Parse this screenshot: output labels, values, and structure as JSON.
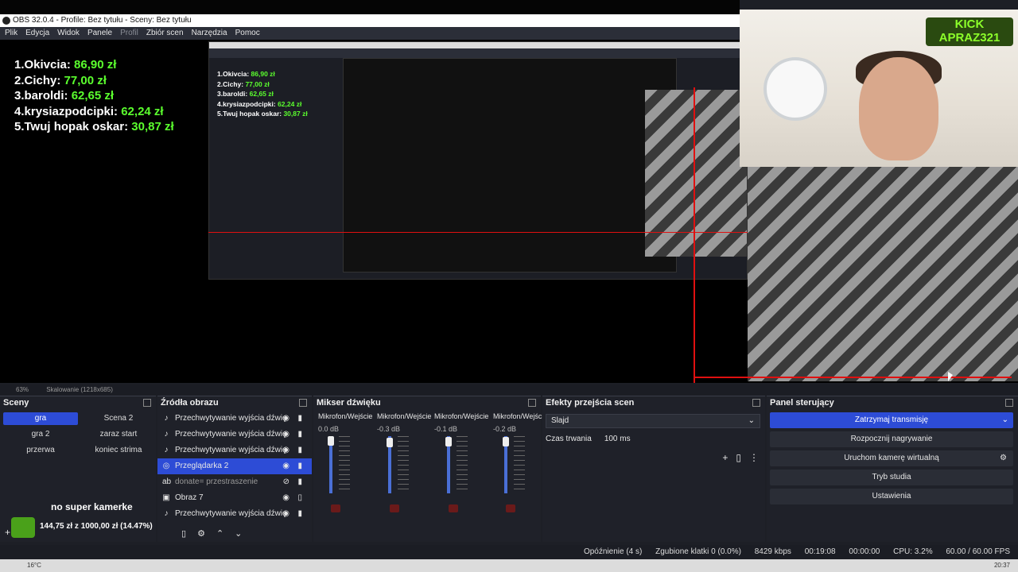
{
  "window": {
    "title": "OBS 32.0.4 - Profile: Bez tytułu - Sceny: Bez tytułu"
  },
  "menu": [
    "Plik",
    "Edycja",
    "Widok",
    "Panele",
    "Profil",
    "Zbiór scen",
    "Narzędzia",
    "Pomoc"
  ],
  "leaderboard": [
    {
      "label": "1.Okivcia: ",
      "value": "86,90 zł"
    },
    {
      "label": "2.Cichy: ",
      "value": "77,00 zł"
    },
    {
      "label": "3.baroldi: ",
      "value": "62,65 zł"
    },
    {
      "label": "4.krysiazpodcipki: ",
      "value": "62,24 zł"
    },
    {
      "label": "5.Twuj hopak oskar: ",
      "value": "30,87 zł"
    }
  ],
  "webcam": {
    "logo": "KICK APRAZ321"
  },
  "overlay": {
    "nsk": "no super kamerke",
    "progress": "144,75 zł z 1000,00 zł (14.47%)"
  },
  "zoom": {
    "level": "63%",
    "scale": "Skalowanie (1218x685)"
  },
  "scenes": {
    "title": "Sceny",
    "items": [
      "gra",
      "Scena 2",
      "gra 2",
      "zaraz start",
      "przerwa",
      "koniec strima"
    ]
  },
  "sources": {
    "title": "Źródła obrazu",
    "items": [
      {
        "label": "Przechwytywanie wyjścia dźwię",
        "icon": "speaker-icon"
      },
      {
        "label": "Przechwytywanie wyjścia dźwię",
        "icon": "speaker-icon"
      },
      {
        "label": "Przechwytywanie wyjścia dźwię",
        "icon": "speaker-icon"
      },
      {
        "label": "Przeglądarka 2",
        "icon": "globe-icon"
      },
      {
        "label": "donate= przestraszenie",
        "icon": "text-icon"
      },
      {
        "label": "Obraz 7",
        "icon": "image-icon"
      },
      {
        "label": "Przechwytywanie wyjścia dźwię",
        "icon": "speaker-icon"
      }
    ]
  },
  "mixer": {
    "title": "Mikser dźwięku",
    "channels": [
      {
        "name": "Mikrofon/Wejście li",
        "db": "0.0 dB"
      },
      {
        "name": "Mikrofon/Wejście li",
        "db": "-0.3 dB"
      },
      {
        "name": "Mikrofon/Wejście li",
        "db": "-0.1 dB"
      },
      {
        "name": "Mikrofon/Wejście",
        "db": "-0.2 dB"
      }
    ],
    "scale": [
      "0",
      "-5",
      "-10",
      "-15",
      "-20",
      "-25",
      "-30",
      "-35",
      "-40",
      "-45",
      "-50",
      "-55",
      "-60"
    ]
  },
  "effects": {
    "title": "Efekty przejścia scen",
    "transition": "Slajd",
    "duration_label": "Czas trwania",
    "duration_value": "100 ms"
  },
  "control": {
    "title": "Panel sterujący",
    "buttons": [
      "Zatrzymaj transmisję",
      "Rozpocznij nagrywanie",
      "Uruchom kamerę wirtualną",
      "Tryb studia",
      "Ustawienia"
    ]
  },
  "status": {
    "delay": "Opóźnienie (4 s)",
    "dropped": "Zgubione klatki 0 (0.0%)",
    "bitrate": "8429 kbps",
    "stream_time": "00:19:08",
    "rec_time": "00:00:00",
    "cpu": "CPU: 3.2%",
    "fps": "60.00 / 60.00 FPS"
  },
  "taskbar": {
    "weather": "16°C",
    "clock": "20:37"
  }
}
